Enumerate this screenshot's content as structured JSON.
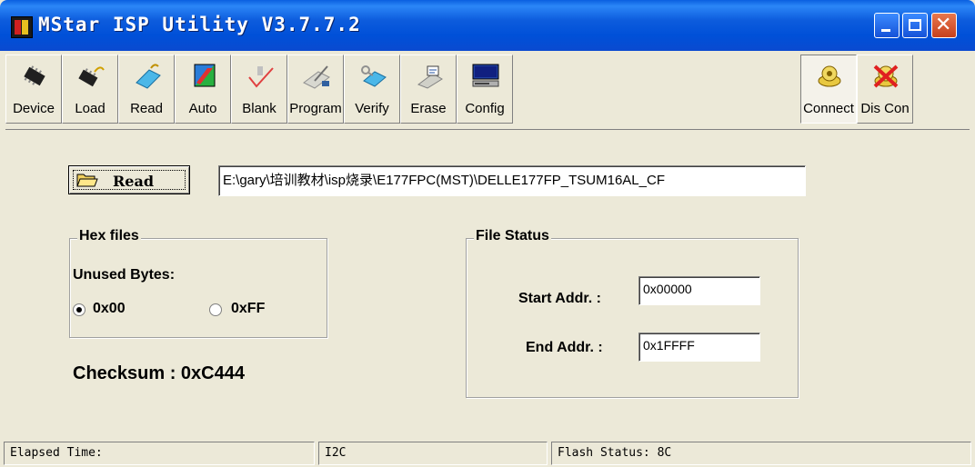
{
  "window": {
    "title": "MStar ISP Utility V3.7.7.2"
  },
  "toolbar": {
    "buttons": [
      {
        "label": "Device",
        "icon": "chip-icon"
      },
      {
        "label": "Load",
        "icon": "load-chip-icon"
      },
      {
        "label": "Read",
        "icon": "read-icon"
      },
      {
        "label": "Auto",
        "icon": "auto-icon"
      },
      {
        "label": "Blank",
        "icon": "blank-check-icon"
      },
      {
        "label": "Program",
        "icon": "program-icon"
      },
      {
        "label": "Verify",
        "icon": "verify-icon"
      },
      {
        "label": "Erase",
        "icon": "erase-icon"
      },
      {
        "label": "Config",
        "icon": "config-icon"
      },
      {
        "label": "Connect",
        "icon": "connect-icon"
      },
      {
        "label": "Dis Con",
        "icon": "disconnect-icon"
      }
    ],
    "active": "Connect"
  },
  "read_section": {
    "button_label": "Read",
    "file_path": "E:\\gary\\培训教材\\isp烧录\\E177FPC(MST)\\DELLE177FP_TSUM16AL_CF"
  },
  "hex_files": {
    "legend": "Hex files",
    "unused_bytes_label": "Unused Bytes:",
    "option_00": "0x00",
    "option_ff": "0xFF",
    "selected": "0x00"
  },
  "checksum": "Checksum : 0xC444",
  "file_status": {
    "legend": "File Status",
    "start_label": "Start Addr. :",
    "start_value": "0x00000",
    "end_label": "End Addr. :",
    "end_value": "0x1FFFF"
  },
  "status_bar": {
    "elapsed": "Elapsed Time:",
    "interface": "I2C",
    "flash_status": "Flash Status: 8C"
  }
}
